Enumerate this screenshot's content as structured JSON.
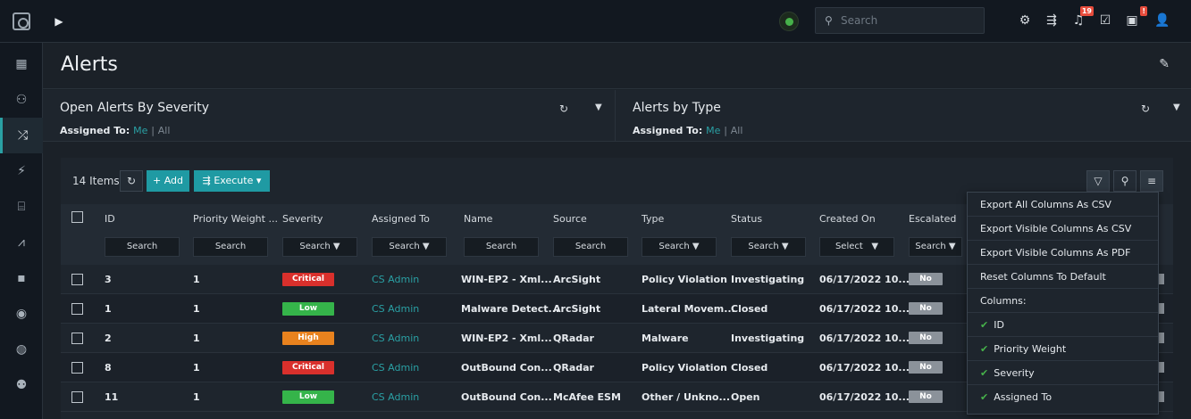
{
  "topbar": {
    "search_placeholder": "Search",
    "notification_count": "19",
    "alert_badge": "!"
  },
  "header": {
    "title": "Alerts"
  },
  "widgets": [
    {
      "title": "Open Alerts By Severity",
      "assigned_label": "Assigned To:",
      "me": "Me",
      "sep": "|",
      "all": "All"
    },
    {
      "title": "Alerts by Type",
      "assigned_label": "Assigned To:",
      "me": "Me",
      "sep": "|",
      "all": "All"
    }
  ],
  "toolbar": {
    "count": "14 Items",
    "add_label": "+ Add",
    "execute_label": "Execute"
  },
  "columns": [
    "ID",
    "Priority Weight ...",
    "Severity",
    "Assigned To",
    "Name",
    "Source",
    "Type",
    "Status",
    "Created On",
    "Escalated"
  ],
  "filters": [
    "Search",
    "Search",
    "Search",
    "Search",
    "Search",
    "Search",
    "Search",
    "Search",
    "Select",
    "Search"
  ],
  "rows": [
    {
      "id": "3",
      "weight": "1",
      "severity": "Critical",
      "assigned": "CS Admin",
      "name": "WIN-EP2 - Xml...",
      "source": "ArcSight",
      "type": "Policy Violation",
      "status": "Investigating",
      "created": "06/17/2022 10...",
      "escalated": "No"
    },
    {
      "id": "1",
      "weight": "1",
      "severity": "Low",
      "assigned": "CS Admin",
      "name": "Malware Detect...",
      "source": "ArcSight",
      "type": "Lateral Movem...",
      "status": "Closed",
      "created": "06/17/2022 10...",
      "escalated": "No"
    },
    {
      "id": "2",
      "weight": "1",
      "severity": "High",
      "assigned": "CS Admin",
      "name": "WIN-EP2 - Xml...",
      "source": "QRadar",
      "type": "Malware",
      "status": "Investigating",
      "created": "06/17/2022 10...",
      "escalated": "No"
    },
    {
      "id": "8",
      "weight": "1",
      "severity": "Critical",
      "assigned": "CS Admin",
      "name": "OutBound Con...",
      "source": "QRadar",
      "type": "Policy Violation",
      "status": "Closed",
      "created": "06/17/2022 10...",
      "escalated": "No"
    },
    {
      "id": "11",
      "weight": "1",
      "severity": "Low",
      "assigned": "CS Admin",
      "name": "OutBound Con...",
      "source": "McAfee ESM",
      "type": "Other / Unkno...",
      "status": "Open",
      "created": "06/17/2022 10...",
      "escalated": "No"
    }
  ],
  "severity_colors": {
    "Critical": "#d9302c",
    "Low": "#35b44a",
    "High": "#e8821e"
  },
  "menu": {
    "items": [
      "Export All Columns As CSV",
      "Export Visible Columns As CSV",
      "Export Visible Columns As PDF",
      "Reset Columns To Default"
    ],
    "columns_header": "Columns:",
    "checked_columns": [
      "ID",
      "Priority Weight",
      "Severity",
      "Assigned To"
    ]
  }
}
